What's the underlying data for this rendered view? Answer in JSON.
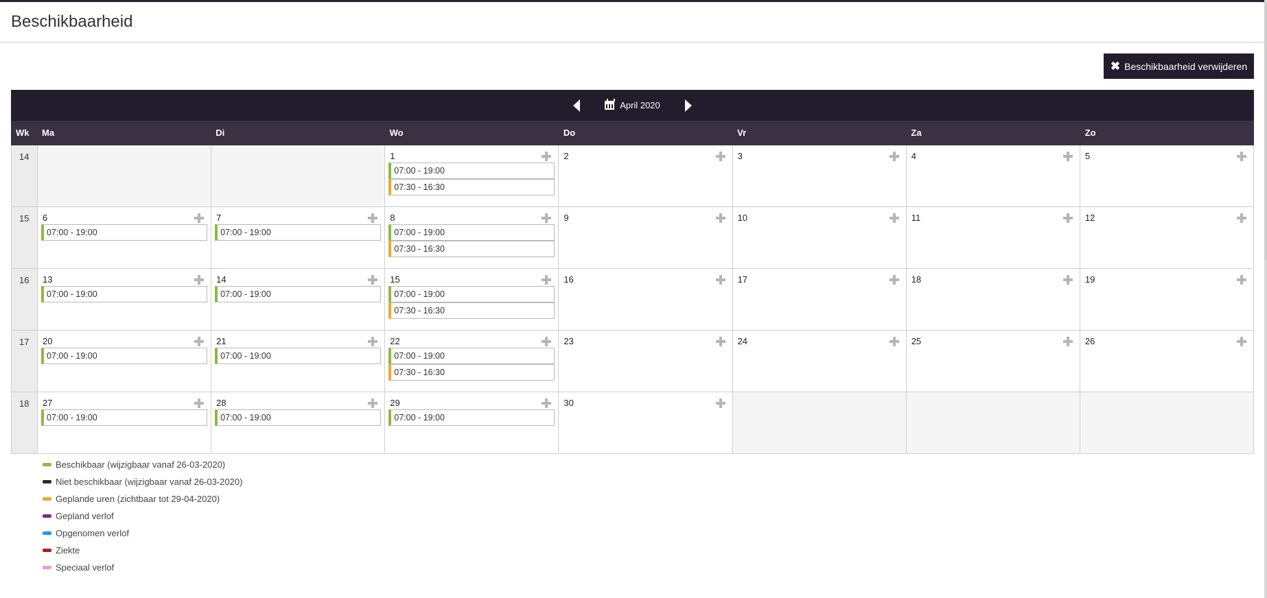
{
  "page": {
    "title": "Beschikbaarheid"
  },
  "toolbar": {
    "delete_label": "Beschikbaarheid verwijderen"
  },
  "calendar": {
    "month_label": "April 2020",
    "week_header": "Wk",
    "day_headers": [
      "Ma",
      "Di",
      "Wo",
      "Do",
      "Vr",
      "Za",
      "Zo"
    ],
    "weeks": [
      {
        "wk": "14",
        "days": [
          {
            "num": "",
            "slots": []
          },
          {
            "num": "",
            "slots": []
          },
          {
            "num": "1",
            "slots": [
              {
                "time": "07:00 - 19:00",
                "color": "green"
              },
              {
                "time": "07:30 - 16:30",
                "color": "orange"
              }
            ]
          },
          {
            "num": "2",
            "slots": []
          },
          {
            "num": "3",
            "slots": []
          },
          {
            "num": "4",
            "slots": []
          },
          {
            "num": "5",
            "slots": []
          }
        ]
      },
      {
        "wk": "15",
        "days": [
          {
            "num": "6",
            "slots": [
              {
                "time": "07:00 - 19:00",
                "color": "green"
              }
            ]
          },
          {
            "num": "7",
            "slots": [
              {
                "time": "07:00 - 19:00",
                "color": "green"
              }
            ]
          },
          {
            "num": "8",
            "slots": [
              {
                "time": "07:00 - 19:00",
                "color": "green"
              },
              {
                "time": "07:30 - 16:30",
                "color": "orange"
              }
            ]
          },
          {
            "num": "9",
            "slots": []
          },
          {
            "num": "10",
            "slots": []
          },
          {
            "num": "11",
            "slots": []
          },
          {
            "num": "12",
            "slots": []
          }
        ]
      },
      {
        "wk": "16",
        "days": [
          {
            "num": "13",
            "slots": [
              {
                "time": "07:00 - 19:00",
                "color": "green"
              }
            ]
          },
          {
            "num": "14",
            "slots": [
              {
                "time": "07:00 - 19:00",
                "color": "green"
              }
            ]
          },
          {
            "num": "15",
            "slots": [
              {
                "time": "07:00 - 19:00",
                "color": "green"
              },
              {
                "time": "07:30 - 16:30",
                "color": "orange"
              }
            ]
          },
          {
            "num": "16",
            "slots": []
          },
          {
            "num": "17",
            "slots": []
          },
          {
            "num": "18",
            "slots": []
          },
          {
            "num": "19",
            "slots": []
          }
        ]
      },
      {
        "wk": "17",
        "days": [
          {
            "num": "20",
            "slots": [
              {
                "time": "07:00 - 19:00",
                "color": "green"
              }
            ]
          },
          {
            "num": "21",
            "slots": [
              {
                "time": "07:00 - 19:00",
                "color": "green"
              }
            ]
          },
          {
            "num": "22",
            "slots": [
              {
                "time": "07:00 - 19:00",
                "color": "green"
              },
              {
                "time": "07:30 - 16:30",
                "color": "orange"
              }
            ]
          },
          {
            "num": "23",
            "slots": []
          },
          {
            "num": "24",
            "slots": []
          },
          {
            "num": "25",
            "slots": []
          },
          {
            "num": "26",
            "slots": []
          }
        ]
      },
      {
        "wk": "18",
        "days": [
          {
            "num": "27",
            "slots": [
              {
                "time": "07:00 - 19:00",
                "color": "green"
              }
            ]
          },
          {
            "num": "28",
            "slots": [
              {
                "time": "07:00 - 19:00",
                "color": "green"
              }
            ]
          },
          {
            "num": "29",
            "slots": [
              {
                "time": "07:00 - 19:00",
                "color": "green"
              }
            ]
          },
          {
            "num": "30",
            "slots": []
          },
          {
            "num": "",
            "slots": []
          },
          {
            "num": "",
            "slots": []
          },
          {
            "num": "",
            "slots": []
          }
        ]
      }
    ]
  },
  "legend": [
    {
      "label": "Beschikbaar (wijzigbaar vanaf 26-03-2020)",
      "color": "#8bbb3f"
    },
    {
      "label": "Niet beschikbaar (wijzigbaar vanaf 26-03-2020)",
      "color": "#2b2b2b"
    },
    {
      "label": "Geplande uren (zichtbaar tot 29-04-2020)",
      "color": "#efa72b"
    },
    {
      "label": "Gepland verlof",
      "color": "#7b2a91"
    },
    {
      "label": "Opgenomen verlof",
      "color": "#2196f3"
    },
    {
      "label": "Ziekte",
      "color": "#b11d1d"
    },
    {
      "label": "Speciaal verlof",
      "color": "#e79be0"
    }
  ],
  "colors": {
    "accent_dark": "#231c2d",
    "header_row": "#3a3143",
    "available": "#8bbb3f",
    "planned": "#efa72b"
  },
  "icons": {
    "delete": "close-icon",
    "prev": "chevron-left-icon",
    "next": "chevron-right-icon",
    "month": "calendar-icon",
    "add": "plus-icon"
  }
}
